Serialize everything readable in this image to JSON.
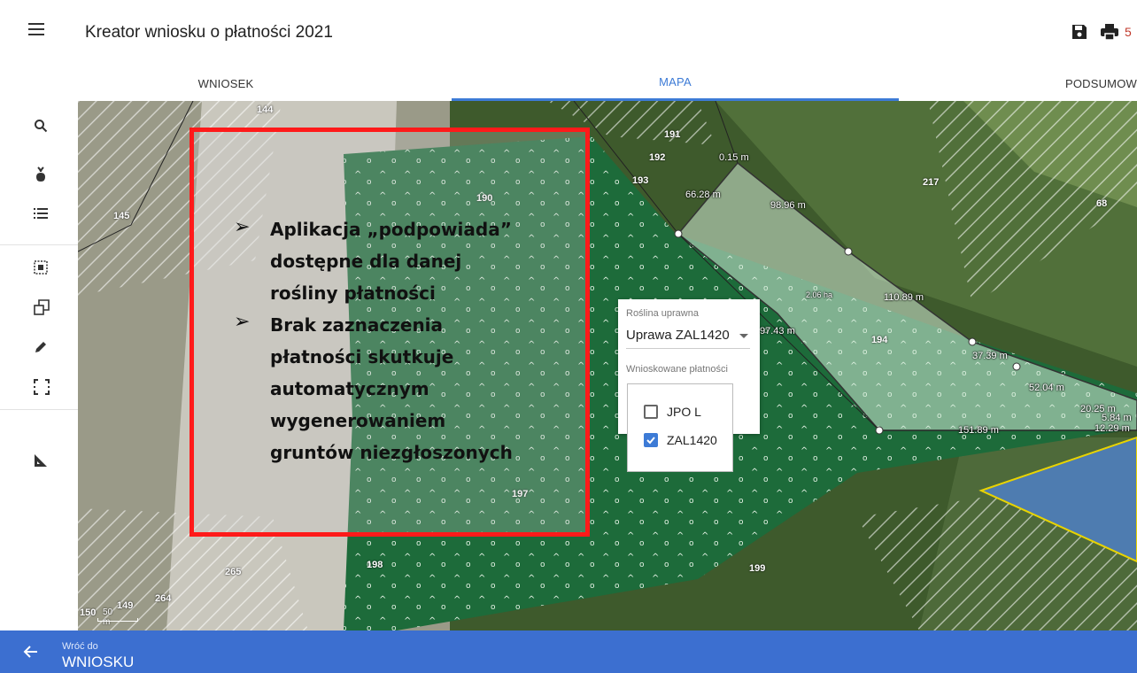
{
  "header": {
    "title": "Kreator wniosku o płatności 2021",
    "count_badge": "5"
  },
  "tabs": [
    {
      "label": "WNIOSEK",
      "active": false
    },
    {
      "label": "MAPA",
      "active": true
    },
    {
      "label": "PODSUMOW",
      "active": false
    }
  ],
  "sidebar": {
    "icons": [
      "search-icon",
      "plant-icon",
      "list-icon",
      "select-area-icon",
      "copy-icon",
      "pencil-icon",
      "crop-frame-icon",
      "ruler-icon"
    ]
  },
  "map": {
    "parcels": [
      "144",
      "145",
      "190",
      "191",
      "192",
      "193",
      "194",
      "197",
      "198",
      "199",
      "217",
      "264",
      "265",
      "149",
      "150",
      "68"
    ],
    "measurements": [
      "0.15 m",
      "66.28 m",
      "98.96 m",
      "2.06 ha",
      "110.89 m",
      "97.43 m",
      "37.39 m",
      "52.04 m",
      "20.25 m",
      "5.84 m",
      "12.29 m",
      "151.89 m"
    ],
    "scale": "50 m"
  },
  "note": {
    "bullet1": [
      "Aplikacja „podpowiada”",
      "dostępne dla danej",
      "rośliny płatności"
    ],
    "bullet2": [
      "Brak zaznaczenia",
      "płatności skutkuje",
      "automatycznym",
      "wygenerowaniem",
      "gruntów niezgłoszonych"
    ]
  },
  "popup": {
    "crop_label": "Roślina uprawna",
    "crop_value": "Uprawa ZAL1420",
    "payments_label": "Wnioskowane płatności",
    "options": [
      {
        "label": "JPO L",
        "checked": false
      },
      {
        "label": "ZAL1420",
        "checked": true
      }
    ]
  },
  "footer": {
    "back_small": "Wróć do",
    "back_big": "WNIOSKU"
  },
  "colors": {
    "accent": "#3d7bd6",
    "footer": "#3c6fd0",
    "highlight_border": "#ff1a1a",
    "crop_green": "#1d6b3a"
  }
}
